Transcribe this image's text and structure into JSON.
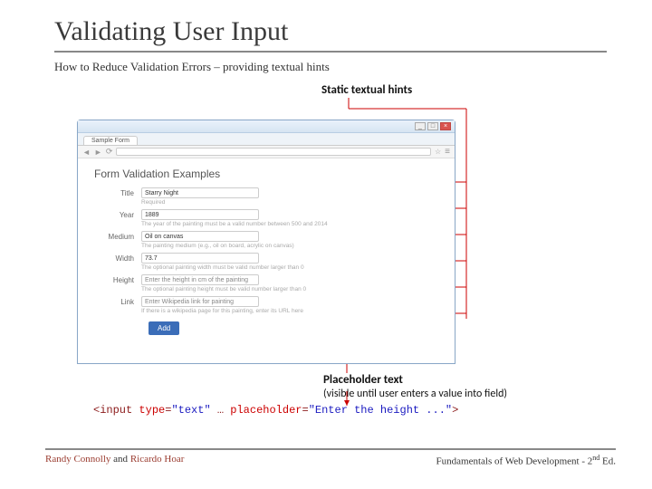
{
  "title": "Validating User Input",
  "subtitle": "How to Reduce Validation Errors – providing textual hints",
  "callouts": {
    "static_hints": "Static textual hints",
    "placeholder_l1": "Placeholder text",
    "placeholder_l2": "(visible until user enters a value into field)"
  },
  "browser": {
    "window_title": "Sample Form",
    "tab_label": "Sample Form",
    "page_heading": "Form Validation Examples",
    "buttons": {
      "min": "_",
      "max": "□",
      "close": "×"
    },
    "nav": {
      "back": "◄",
      "fwd": "►",
      "reload": "⟳",
      "star": "☆",
      "menu": "≡"
    }
  },
  "form": {
    "rows": [
      {
        "label": "Title",
        "value": "Starry Night",
        "filled": true,
        "hint": "Required"
      },
      {
        "label": "Year",
        "value": "1889",
        "filled": true,
        "hint": "The year of the painting must be a valid number between 500 and 2014"
      },
      {
        "label": "Medium",
        "value": "Oil on canvas",
        "filled": true,
        "hint": "The painting medium (e.g., oil on board, acrylic on canvas)"
      },
      {
        "label": "Width",
        "value": "73.7",
        "filled": true,
        "hint": "The optional painting width must be valid number larger than 0"
      },
      {
        "label": "Height",
        "value": "Enter the height in cm of the painting",
        "filled": false,
        "hint": "The optional painting height must be valid number larger than 0"
      },
      {
        "label": "Link",
        "value": "Enter Wikipedia link for painting",
        "filled": false,
        "hint": "If there is a wikipedia page for this painting, enter its URL here"
      }
    ],
    "add_button": "Add"
  },
  "code": {
    "open": "<input",
    "type_attr": "type",
    "type_val": "\"text\"",
    "ellipsis": "…",
    "ph_attr": "placeholder",
    "ph_val": "\"Enter the height ...\"",
    "close": ">"
  },
  "footer": {
    "author1": "Randy Connolly",
    "and": " and ",
    "author2": "Ricardo Hoar",
    "book1": "Fundamentals of Web Development - 2",
    "ord": "nd",
    "book2": " Ed."
  }
}
